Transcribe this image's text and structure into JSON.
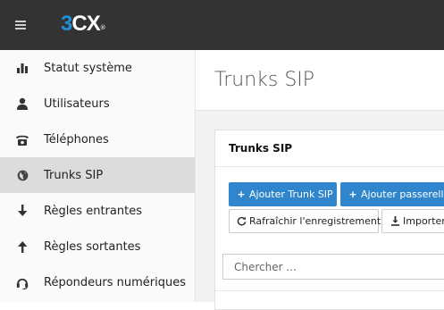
{
  "header": {
    "logo_num": "3",
    "logo_text": "CX",
    "logo_mark": "®"
  },
  "sidebar": {
    "items": [
      {
        "label": "Statut système",
        "icon": "bar-chart-icon"
      },
      {
        "label": "Utilisateurs",
        "icon": "user-icon"
      },
      {
        "label": "Téléphones",
        "icon": "telephone-icon"
      },
      {
        "label": "Trunks SIP",
        "icon": "globe-icon",
        "active": true
      },
      {
        "label": "Règles entrantes",
        "icon": "arrow-down-icon"
      },
      {
        "label": "Règles sortantes",
        "icon": "arrow-up-icon"
      },
      {
        "label": "Répondeurs numériques",
        "icon": "headset-icon"
      }
    ]
  },
  "main": {
    "title": "Trunks SIP",
    "panel": {
      "title": "Trunks SIP",
      "buttons": {
        "add_trunk": "Ajouter Trunk SIP",
        "add_gateway": "Ajouter passerelle",
        "refresh": "Rafraîchir l'enregistrement",
        "import": "Importer"
      },
      "search": {
        "placeholder": "Chercher ..."
      }
    }
  },
  "colors": {
    "topbar": "#333333",
    "accent": "#2f86cc",
    "active_item": "#dcdcdc"
  }
}
